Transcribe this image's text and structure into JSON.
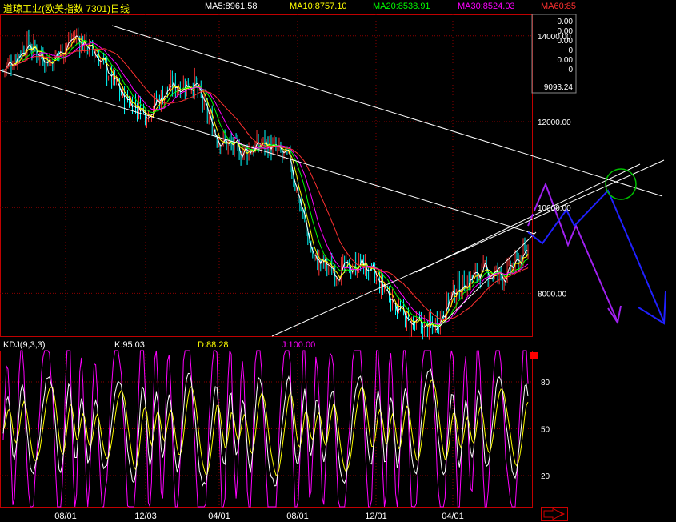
{
  "header": {
    "title": "道琼工业(欧美指数 7301)日线",
    "ma5": "MA5:8961.58",
    "ma10": "MA10:8757.10",
    "ma20": "MA20:8538.91",
    "ma30": "MA30:8524.03",
    "ma60": "MA60:85"
  },
  "kdj_header": {
    "title": "KDJ(9,3,3)",
    "k": "K:95.03",
    "d": "D:88.28",
    "j": "J:100.00"
  },
  "colors": {
    "background": "#000000",
    "grid": "#8b0000",
    "axis": "#c00000",
    "ma5": "#ffffff",
    "ma10": "#ffff00",
    "ma20": "#00ff00",
    "ma30": "#ff00ff",
    "ma60": "#ff3030",
    "candle_up": "#ff3333",
    "candle_down": "#00ffff",
    "trendline": "#ffffff",
    "forecast_purple": "#a020f0",
    "forecast_blue": "#2020ff",
    "circle": "#00c000"
  },
  "chart_data": [
    {
      "type": "candlestick",
      "title": "道琼工业(欧美指数 7301)日线",
      "x": [
        "08/01",
        "12/03",
        "04/01",
        "08/01",
        "12/01",
        "04/01"
      ],
      "y_ticks": [
        "14000.00",
        "12000.00",
        "10000.00",
        "8000.00"
      ],
      "ylim": [
        7000,
        14500
      ],
      "corner_values": [
        "0.00",
        "0.00",
        "0.00",
        "0",
        "0.00",
        "0"
      ],
      "price_marker": "9093.24",
      "series_close": [
        {
          "x": "2007-05",
          "y": 13200
        },
        {
          "x": "2007-07",
          "y": 13800
        },
        {
          "x": "2007-08",
          "y": 13400
        },
        {
          "x": "2007-10",
          "y": 14000
        },
        {
          "x": "2007-12",
          "y": 13500
        },
        {
          "x": "2008-01",
          "y": 12600
        },
        {
          "x": "2008-03",
          "y": 12200
        },
        {
          "x": "2008-04",
          "y": 12800
        },
        {
          "x": "2008-05",
          "y": 12900
        },
        {
          "x": "2008-06",
          "y": 11600
        },
        {
          "x": "2008-07",
          "y": 11300
        },
        {
          "x": "2008-08",
          "y": 11500
        },
        {
          "x": "2008-09",
          "y": 11100
        },
        {
          "x": "2008-10",
          "y": 8800
        },
        {
          "x": "2008-11",
          "y": 8500
        },
        {
          "x": "2008-12",
          "y": 8700
        },
        {
          "x": "2009-01",
          "y": 8100
        },
        {
          "x": "2009-02",
          "y": 7300
        },
        {
          "x": "2009-03",
          "y": 7200
        },
        {
          "x": "2009-04",
          "y": 8100
        },
        {
          "x": "2009-05",
          "y": 8500
        },
        {
          "x": "2009-06",
          "y": 8400
        },
        {
          "x": "2009-07",
          "y": 9000
        }
      ],
      "legend": [
        "MA5:8961.58",
        "MA10:8757.10",
        "MA20:8538.91",
        "MA30:8524.03",
        "MA60:85"
      ]
    },
    {
      "type": "line",
      "title": "KDJ(9,3,3)",
      "series": [
        {
          "name": "K:95.03"
        },
        {
          "name": "D:88.28"
        },
        {
          "name": "J:100.00"
        }
      ],
      "y_ticks": [
        "80",
        "50",
        "20"
      ],
      "ylim": [
        0,
        100
      ]
    }
  ]
}
